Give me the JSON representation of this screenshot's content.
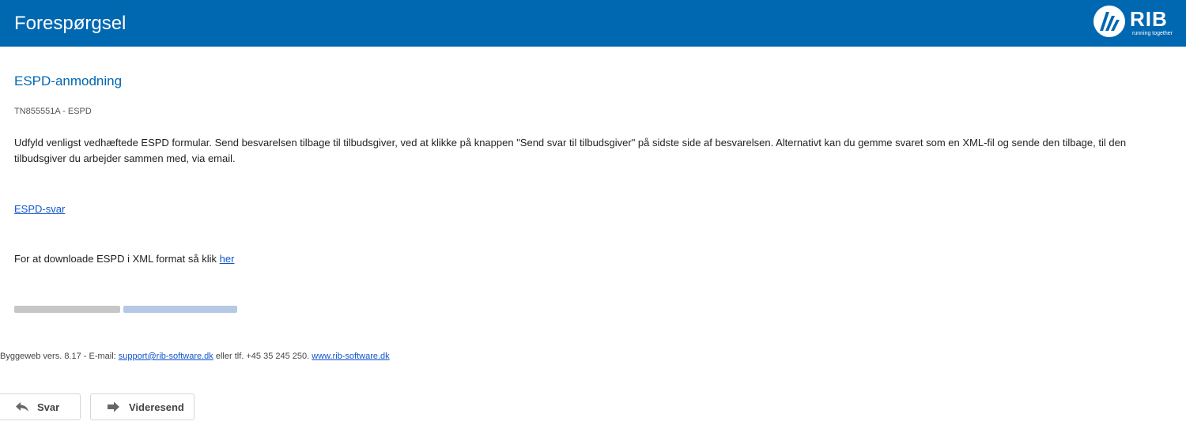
{
  "header": {
    "title": "Forespørgsel",
    "logo": {
      "text": "RIB",
      "tagline": "running together",
      "icon": "rib-logo-icon"
    },
    "color": "#0067b1"
  },
  "content": {
    "title": "ESPD-anmodning",
    "reference": "TN855551A - ESPD",
    "instructions": "Udfyld venligst vedhæftede ESPD formular. Send besvarelsen tilbage til tilbudsgiver, ved at klikke på knappen \"Send svar til tilbudsgiver\" på sidste side af besvarelsen. Alternativt kan du gemme svaret som en XML-fil og sende den tilbage, til den tilbudsgiver du arbejder sammen med, via email.",
    "espd_link": "ESPD-svar",
    "download_prefix": "For at downloade ESPD i XML format så klik ",
    "download_link": "her"
  },
  "footer": {
    "prefix": "Byggeweb vers. 8.17 - E-mail: ",
    "email": "support@rib-software.dk",
    "middle": " eller tlf. +45 35 245 250. ",
    "website": "www.rib-software.dk"
  },
  "actions": {
    "reply": {
      "label": "Svar",
      "icon": "reply-arrow-icon"
    },
    "forward": {
      "label": "Videresend",
      "icon": "forward-arrow-icon"
    }
  }
}
